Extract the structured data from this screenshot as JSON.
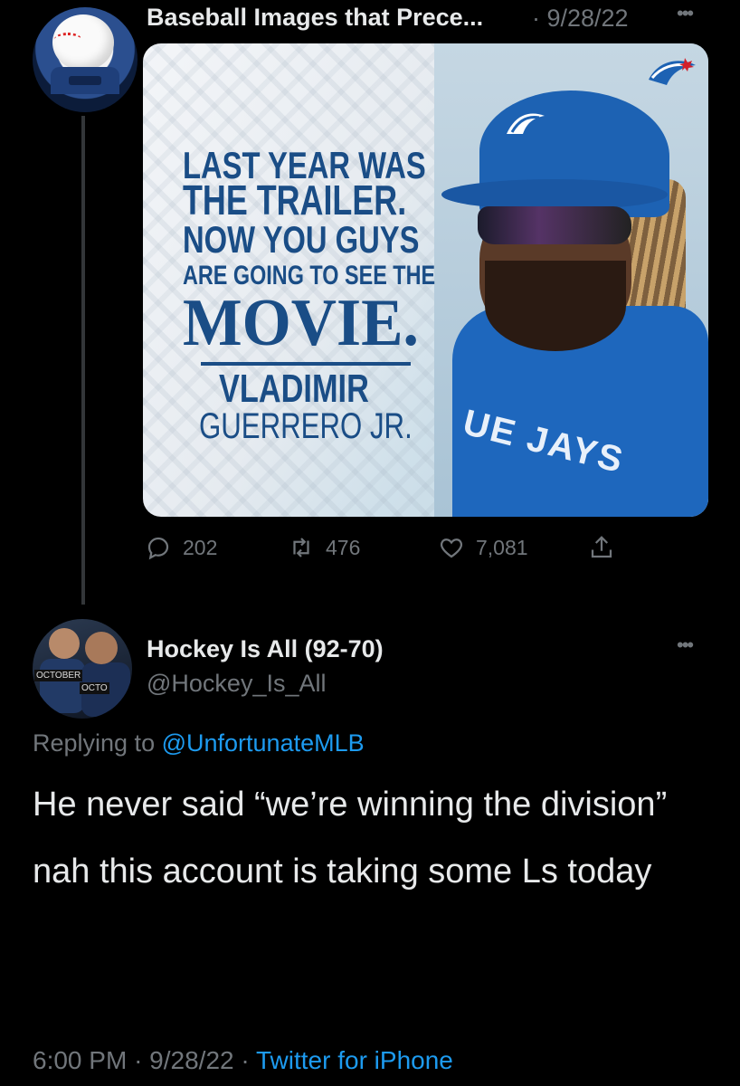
{
  "tweet1": {
    "name": "Baseball Images that Prece...",
    "date": "· 9/28/22",
    "media": {
      "quote_lines": [
        "LAST YEAR WAS",
        "THE TRAILER.",
        "NOW YOU GUYS",
        "ARE GOING TO SEE THE",
        "MOVIE."
      ],
      "attribution": [
        "VLADIMIR",
        "GUERRERO JR."
      ],
      "jersey_text": "UE JAYS"
    },
    "actions": {
      "replies": "202",
      "retweets": "476",
      "likes": "7,081"
    }
  },
  "tweet2": {
    "name": "Hockey Is All (92-70)",
    "handle": "@Hockey_Is_All",
    "replying_prefix": "Replying to",
    "replying_to": "@UnfortunateMLB",
    "paragraphs": [
      "He never said “we’re winning the division”",
      "nah this account is taking some Ls today"
    ],
    "time": "6:00 PM",
    "date": "· 9/28/22 ·",
    "source": "Twitter for iPhone",
    "avatar_tags": [
      "OCTOBER",
      "OCTO"
    ]
  },
  "colors": {
    "background": "#000000",
    "text": "#e7e9ea",
    "muted": "#71767b",
    "link": "#1d9bf0",
    "jays_blue": "#1a4d86"
  },
  "icons": [
    "more-icon",
    "reply-icon",
    "retweet-icon",
    "like-icon",
    "share-icon"
  ]
}
